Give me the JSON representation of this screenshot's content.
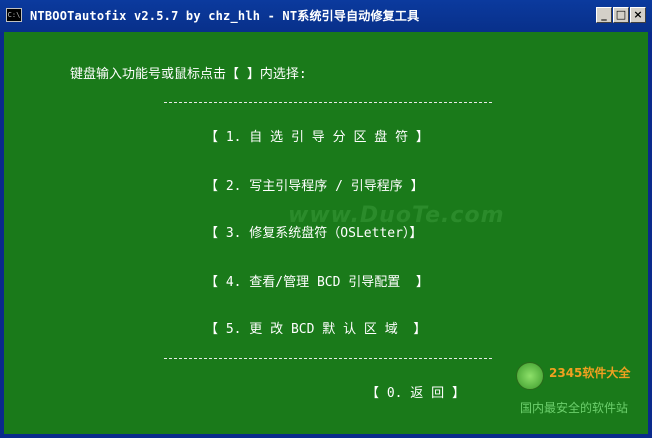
{
  "window": {
    "title": "NTBOOTautofix v2.5.7 by chz_hlh - NT系统引导自动修复工具",
    "icon_text": "C:\\",
    "controls": {
      "minimize": "_",
      "maximize": "□",
      "close": "×"
    }
  },
  "console": {
    "prompt": "键盘输入功能号或鼠标点击【 】内选择:",
    "divider": "----------------------------------------",
    "menu": [
      {
        "label": "【 1. 自 选 引 导 分 区 盘 符 】"
      },
      {
        "label": "【 2. 写主引导程序 / 引导程序 】"
      },
      {
        "label": "【 3. 修复系统盘符（OSLetter）】"
      },
      {
        "label": "【 4. 查看/管理 BCD 引导配置  】"
      },
      {
        "label": "【 5. 更 改 BCD 默 认 区 域  】"
      }
    ],
    "back": "【 0. 返 回 】"
  },
  "watermark": {
    "duote": "www.DuoTe.com",
    "brand_2345": "2345软件大全",
    "tagline": "国内最安全的软件站"
  },
  "colors": {
    "console_bg": "#1a7a1a",
    "titlebar_bg": "#0b3a9e",
    "text": "#ffffff",
    "brand_2345": "#f0a020"
  }
}
